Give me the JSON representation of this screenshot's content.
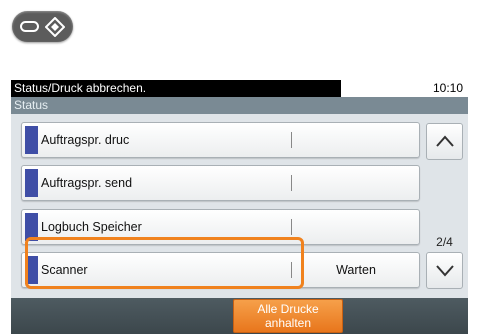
{
  "hardware_key": {
    "icon": "diamond-icon"
  },
  "header": {
    "title": "Status/Druck abbrechen.",
    "time": "10:10"
  },
  "status_label": "Status",
  "rows": [
    {
      "label": "Auftragspr. druc",
      "value": ""
    },
    {
      "label": "Auftragspr. send",
      "value": ""
    },
    {
      "label": "Logbuch Speicher",
      "value": ""
    },
    {
      "label": "Scanner",
      "value": "Warten"
    }
  ],
  "page_indicator": "2/4",
  "stop_button": {
    "line1": "Alle Drucke",
    "line2": "anhalten"
  },
  "colors": {
    "accent": "#3f4ea6",
    "highlight": "#f0821e",
    "button": "#e8761c",
    "panel": "#5d6b73"
  }
}
